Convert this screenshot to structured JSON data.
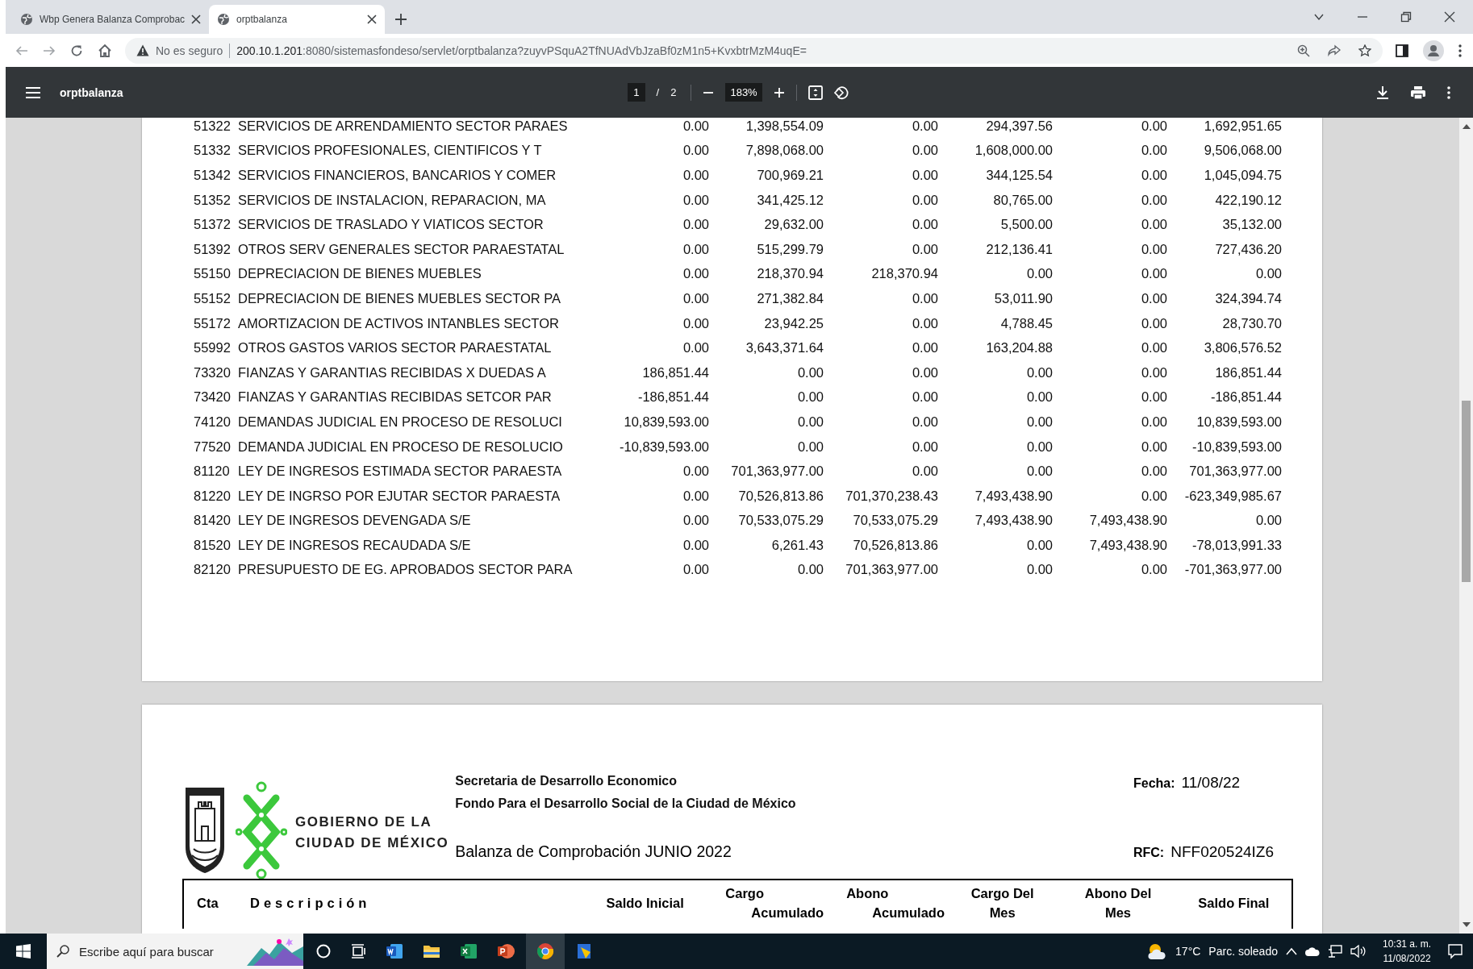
{
  "browser": {
    "tabs": [
      {
        "title": "Wbp Genera Balanza Comprobac",
        "selected": false
      },
      {
        "title": "orptbalanza",
        "selected": true
      }
    ],
    "security": "No es seguro",
    "url_host": "200.10.1.201",
    "url_rest": ":8080/sistemasfondeso/servlet/orptbalanza?zuyvPSquA2TfNUAdVbJzaBf0zM1n5+KvxbtrMzM4uqE="
  },
  "viewer": {
    "title": "orptbalanza",
    "page": "1",
    "separator": "/",
    "pages": "2",
    "zoom": "183%"
  },
  "page1": {
    "rows": [
      {
        "cta": "51322",
        "descripcion": "SERVICIOS DE ARRENDAMIENTO SECTOR PARAES",
        "values": [
          "0.00",
          "1,398,554.09",
          "0.00",
          "294,397.56",
          "0.00",
          "1,692,951.65"
        ]
      },
      {
        "cta": "51332",
        "descripcion": "SERVICIOS PROFESIONALES, CIENTIFICOS Y T",
        "values": [
          "0.00",
          "7,898,068.00",
          "0.00",
          "1,608,000.00",
          "0.00",
          "9,506,068.00"
        ]
      },
      {
        "cta": "51342",
        "descripcion": "SERVICIOS FINANCIEROS, BANCARIOS Y COMER",
        "values": [
          "0.00",
          "700,969.21",
          "0.00",
          "344,125.54",
          "0.00",
          "1,045,094.75"
        ]
      },
      {
        "cta": "51352",
        "descripcion": "SERVICIOS DE INSTALACION, REPARACION, MA",
        "values": [
          "0.00",
          "341,425.12",
          "0.00",
          "80,765.00",
          "0.00",
          "422,190.12"
        ]
      },
      {
        "cta": "51372",
        "descripcion": "SERVICIOS DE TRASLADO Y VIATICOS SECTOR",
        "values": [
          "0.00",
          "29,632.00",
          "0.00",
          "5,500.00",
          "0.00",
          "35,132.00"
        ]
      },
      {
        "cta": "51392",
        "descripcion": "OTROS SERV GENERALES SECTOR PARAESTATAL",
        "values": [
          "0.00",
          "515,299.79",
          "0.00",
          "212,136.41",
          "0.00",
          "727,436.20"
        ]
      },
      {
        "cta": "55150",
        "descripcion": "DEPRECIACION DE BIENES MUEBLES",
        "values": [
          "0.00",
          "218,370.94",
          "218,370.94",
          "0.00",
          "0.00",
          "0.00"
        ]
      },
      {
        "cta": "55152",
        "descripcion": "DEPRECIACION DE BIENES MUEBLES SECTOR PA",
        "values": [
          "0.00",
          "271,382.84",
          "0.00",
          "53,011.90",
          "0.00",
          "324,394.74"
        ]
      },
      {
        "cta": "55172",
        "descripcion": "AMORTIZACION DE ACTIVOS INTANBLES SECTOR",
        "values": [
          "0.00",
          "23,942.25",
          "0.00",
          "4,788.45",
          "0.00",
          "28,730.70"
        ]
      },
      {
        "cta": "55992",
        "descripcion": "OTROS GASTOS VARIOS SECTOR PARAESTATAL",
        "values": [
          "0.00",
          "3,643,371.64",
          "0.00",
          "163,204.88",
          "0.00",
          "3,806,576.52"
        ]
      },
      {
        "cta": "73320",
        "descripcion": "FIANZAS Y GARANTIAS RECIBIDAS X DUEDAS A",
        "values": [
          "186,851.44",
          "0.00",
          "0.00",
          "0.00",
          "0.00",
          "186,851.44"
        ]
      },
      {
        "cta": "73420",
        "descripcion": "FIANZAS Y GARANTIAS RECIBIDAS SETCOR PAR",
        "values": [
          "-186,851.44",
          "0.00",
          "0.00",
          "0.00",
          "0.00",
          "-186,851.44"
        ]
      },
      {
        "cta": "74120",
        "descripcion": "DEMANDAS JUDICIAL EN PROCESO DE RESOLUCI",
        "values": [
          "10,839,593.00",
          "0.00",
          "0.00",
          "0.00",
          "0.00",
          "10,839,593.00"
        ]
      },
      {
        "cta": "77520",
        "descripcion": "DEMANDA JUDICIAL EN PROCESO DE RESOLUCIO",
        "values": [
          "-10,839,593.00",
          "0.00",
          "0.00",
          "0.00",
          "0.00",
          "-10,839,593.00"
        ]
      },
      {
        "cta": "81120",
        "descripcion": "LEY DE INGRESOS ESTIMADA SECTOR PARAESTA",
        "values": [
          "0.00",
          "701,363,977.00",
          "0.00",
          "0.00",
          "0.00",
          "701,363,977.00"
        ]
      },
      {
        "cta": "81220",
        "descripcion": "LEY DE INGRSO POR EJUTAR SECTOR PARAESTA",
        "values": [
          "0.00",
          "70,526,813.86",
          "701,370,238.43",
          "7,493,438.90",
          "0.00",
          "-623,349,985.67"
        ]
      },
      {
        "cta": "81420",
        "descripcion": "LEY DE INGRESOS DEVENGADA S/E",
        "values": [
          "0.00",
          "70,533,075.29",
          "70,533,075.29",
          "7,493,438.90",
          "7,493,438.90",
          "0.00"
        ]
      },
      {
        "cta": "81520",
        "descripcion": "LEY DE INGRESOS RECAUDADA S/E",
        "values": [
          "0.00",
          "6,261.43",
          "70,526,813.86",
          "0.00",
          "7,493,438.90",
          "-78,013,991.33"
        ]
      },
      {
        "cta": "82120",
        "descripcion": "PRESUPUESTO DE EG. APROBADOS SECTOR PARA",
        "values": [
          "0.00",
          "0.00",
          "701,363,977.00",
          "0.00",
          "0.00",
          "-701,363,977.00"
        ]
      }
    ]
  },
  "page2": {
    "logo_text": [
      "GOBIERNO DE LA",
      "CIUDAD DE MÉXICO"
    ],
    "org_lines": [
      "Secretaria de Desarrollo Economico",
      "Fondo Para el Desarrollo Social de la Ciudad de México"
    ],
    "fecha_label": "Fecha:",
    "fecha": "11/08/22",
    "report_title": "Balanza de Comprobación JUNIO 2022",
    "rfc_label": "RFC:",
    "rfc": "NFF020524IZ6",
    "columns": [
      {
        "label": "Cta",
        "kind": "left"
      },
      {
        "label": "Descripción",
        "kind": "spaced"
      },
      {
        "label": "Saldo Inicial",
        "kind": "single"
      },
      {
        "label": "Cargo\nAcumulado",
        "kind": "double"
      },
      {
        "label": "Abono\nAcumulado",
        "kind": "double"
      },
      {
        "label": "Cargo Del\nMes",
        "kind": "single2"
      },
      {
        "label": "Abono Del\nMes",
        "kind": "single2"
      },
      {
        "label": "Saldo Final",
        "kind": "single"
      }
    ]
  },
  "taskbar": {
    "search_placeholder": "Escribe aquí para buscar",
    "temperature": "17°C",
    "weather": "Parc. soleado",
    "time": "10:31 a. m.",
    "date": "11/08/2022"
  }
}
